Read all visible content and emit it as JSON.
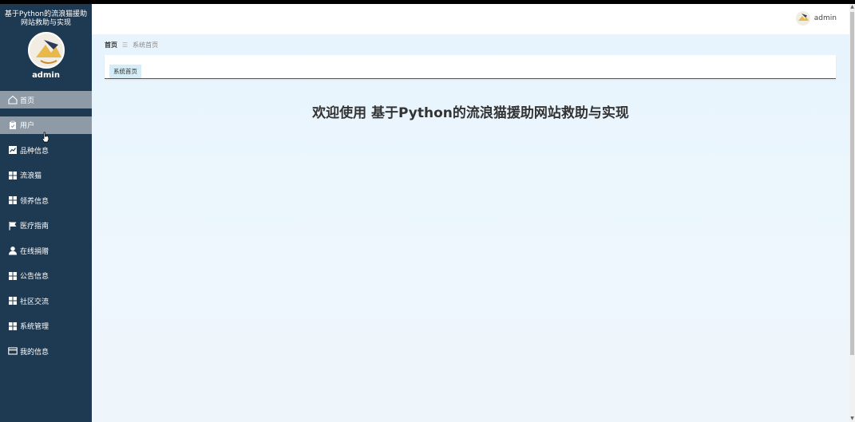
{
  "sidebar": {
    "title": "基于Python的流浪猫援助网站救助与实现",
    "username": "admin",
    "items": [
      {
        "label": "首页",
        "icon": "home-icon"
      },
      {
        "label": "用户",
        "icon": "clipboard-icon"
      },
      {
        "label": "品种信息",
        "icon": "chart-icon"
      },
      {
        "label": "流浪猫",
        "icon": "grid-icon"
      },
      {
        "label": "领养信息",
        "icon": "grid-icon"
      },
      {
        "label": "医疗指南",
        "icon": "flag-icon"
      },
      {
        "label": "在线捐赠",
        "icon": "user-icon"
      },
      {
        "label": "公告信息",
        "icon": "grid-icon"
      },
      {
        "label": "社区交流",
        "icon": "grid-icon"
      },
      {
        "label": "系统管理",
        "icon": "grid-icon"
      },
      {
        "label": "我的信息",
        "icon": "card-icon"
      }
    ]
  },
  "header": {
    "username": "admin"
  },
  "breadcrumb": {
    "home": "首页",
    "separator": "☰",
    "current": "系统首页"
  },
  "tabs": [
    {
      "label": "系统首页"
    }
  ],
  "main": {
    "welcome": "欢迎使用 基于Python的流浪猫援助网站救助与实现"
  },
  "colors": {
    "sidebar_bg": "#1e3a52",
    "active_item_bg": "#8e9aa6",
    "main_bg": "#e7f4fd",
    "tab_bg": "#d4eef9"
  }
}
